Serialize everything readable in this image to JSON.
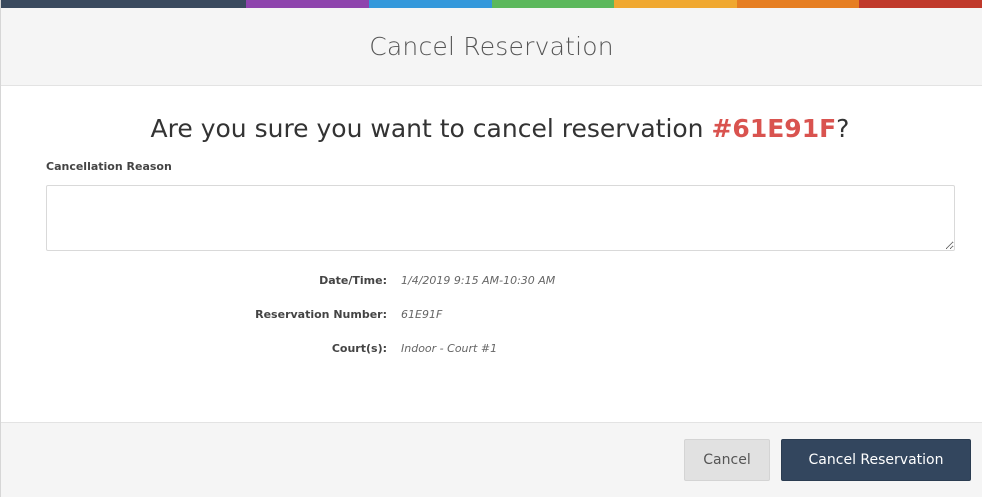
{
  "header": {
    "title": "Cancel Reservation",
    "stripe_colors": [
      "#3a4a5e",
      "#3a4a5e",
      "#8e44ad",
      "#3498db",
      "#5cb85c",
      "#f0a830",
      "#e67e22",
      "#c0392b"
    ]
  },
  "body": {
    "question_prefix": "Are you sure you want to cancel reservation",
    "reservation_code": "#61E91F",
    "question_suffix": "?",
    "reason_label": "Cancellation Reason",
    "reason_value": "",
    "details": [
      {
        "label": "Date/Time:",
        "value": "1/4/2019 9:15 AM-10:30 AM"
      },
      {
        "label": "Reservation Number:",
        "value": "61E91F"
      },
      {
        "label": "Court(s):",
        "value": "Indoor - Court #1"
      }
    ]
  },
  "footer": {
    "cancel_label": "Cancel",
    "confirm_label": "Cancel Reservation"
  },
  "colors": {
    "accent_red": "#d9534f",
    "primary_button": "#33465e"
  }
}
